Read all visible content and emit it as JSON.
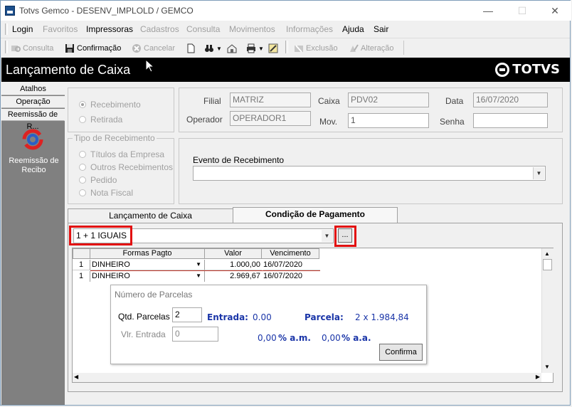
{
  "window": {
    "title": "Totvs Gemco - DESENV_IMPLOLD / GEMCO",
    "minimize": "—",
    "maximize": "☐",
    "close": "✕"
  },
  "menu": [
    {
      "label": "Login",
      "enabled": true
    },
    {
      "label": "Favoritos",
      "enabled": false
    },
    {
      "label": "Impressoras",
      "enabled": true
    },
    {
      "label": "Cadastros",
      "enabled": false
    },
    {
      "label": "Consulta",
      "enabled": false
    },
    {
      "label": "Movimentos",
      "enabled": false
    },
    {
      "label": "Informações",
      "enabled": false
    },
    {
      "label": "Ajuda",
      "enabled": true
    },
    {
      "label": "Sair",
      "enabled": true
    }
  ],
  "toolbar": {
    "consulta": "Consulta",
    "confirmacao": "Confirmação",
    "cancelar": "Cancelar",
    "exclusao": "Exclusão",
    "alteracao": "Alteração"
  },
  "header": {
    "title": "Lançamento de Caixa",
    "logo": "TOTVS"
  },
  "sidebar": {
    "tabs": [
      "Atalhos",
      "Operação",
      "Reemissão de R..."
    ],
    "icon_label": "Reemissão de Recibo"
  },
  "operation": {
    "options": [
      "Recebimento",
      "Retirada"
    ]
  },
  "tipo_recebimento": {
    "legend": "Tipo de Recebimento",
    "options": [
      "Títulos da Empresa",
      "Outros Recebimentos",
      "Pedido",
      "Nota Fiscal"
    ]
  },
  "fields": {
    "filial_label": "Filial",
    "filial": "MATRIZ",
    "caixa_label": "Caixa",
    "caixa": "PDV02",
    "data_label": "Data",
    "data": "16/07/2020",
    "operador_label": "Operador",
    "operador": "OPERADOR1",
    "mov_label": "Mov.",
    "mov": "1",
    "senha_label": "Senha",
    "senha": ""
  },
  "evento": {
    "label": "Evento de Recebimento",
    "value": ""
  },
  "tabs": [
    "Lançamento de Caixa",
    "Condição de Pagamento"
  ],
  "condicao": {
    "value": "1 + 1 IGUAIS",
    "lookup": "..."
  },
  "grid": {
    "headers": [
      "Formas Pagto",
      "Valor",
      "Vencimento"
    ],
    "rows": [
      {
        "num": "1",
        "forma": "DINHEIRO",
        "valor": "1.000,00",
        "vencimento": "16/07/2020"
      },
      {
        "num": "1",
        "forma": "DINHEIRO",
        "valor": "2.969,67",
        "vencimento": "16/07/2020"
      }
    ]
  },
  "parcelas": {
    "title": "Número de Parcelas",
    "qtd_label": "Qtd. Parcelas",
    "qtd": "2",
    "vlr_label": "Vlr. Entrada",
    "vlr": "0",
    "entrada_label": "Entrada:",
    "entrada": "0.00",
    "parcela_label": "Parcela:",
    "parcela": "2 x 1.984,84",
    "am_value": "0,00",
    "am_unit": "% a.m.",
    "aa_value": "0,00",
    "aa_unit": "% a.a.",
    "confirm": "Confirma"
  }
}
